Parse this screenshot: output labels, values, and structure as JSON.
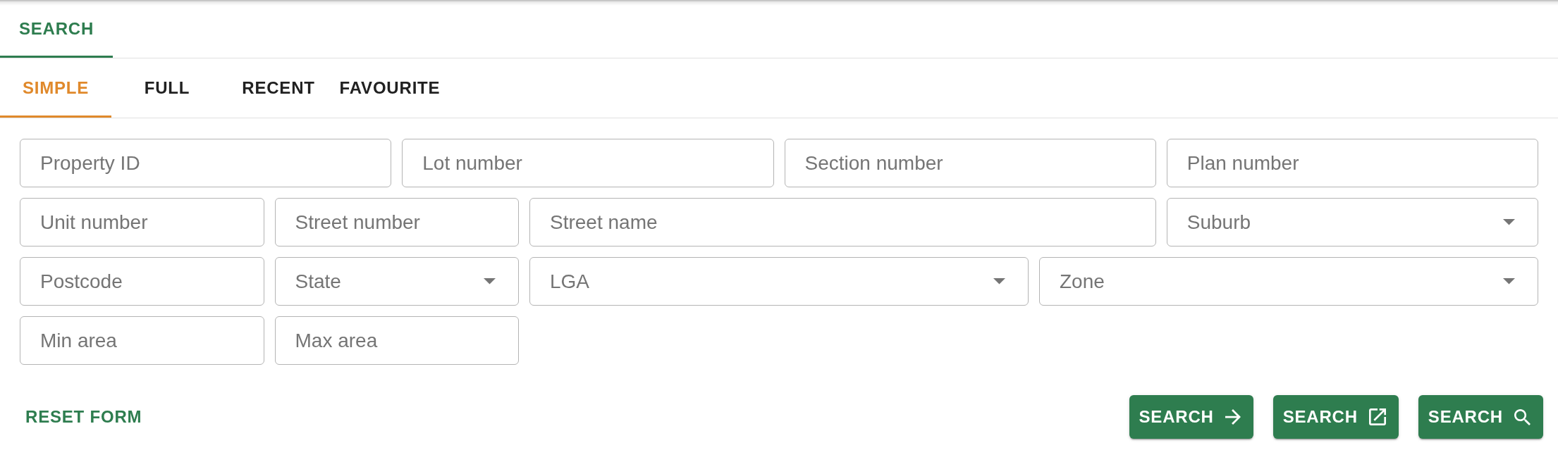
{
  "tabs": [
    {
      "label": "SEARCH",
      "selected": true
    }
  ],
  "search_modes": [
    {
      "label": "SIMPLE",
      "selected": true
    },
    {
      "label": "FULL",
      "selected": false
    },
    {
      "label": "RECENT",
      "selected": false
    },
    {
      "label": "FAVOURITE",
      "selected": false
    }
  ],
  "fields": [
    {
      "kind": "text",
      "placeholder": "Property ID"
    },
    {
      "kind": "text",
      "placeholder": "Lot number"
    },
    {
      "kind": "text",
      "placeholder": "Section number"
    },
    {
      "kind": "text",
      "placeholder": "Plan number"
    },
    {
      "kind": "text",
      "placeholder": "Unit number"
    },
    {
      "kind": "text",
      "placeholder": "Street number"
    },
    {
      "kind": "text",
      "placeholder": "Street name"
    },
    {
      "kind": "select",
      "placeholder": "Suburb"
    },
    {
      "kind": "text",
      "placeholder": "Postcode"
    },
    {
      "kind": "select",
      "placeholder": "State"
    },
    {
      "kind": "select",
      "placeholder": "LGA"
    },
    {
      "kind": "select",
      "placeholder": "Zone"
    },
    {
      "kind": "text",
      "placeholder": "Min area"
    },
    {
      "kind": "text",
      "placeholder": "Max area"
    }
  ],
  "reset_button": {
    "label": "RESET FORM"
  },
  "search_buttons": [
    {
      "label": "SEARCH",
      "kind": "forward"
    },
    {
      "label": "SEARCH",
      "kind": "external"
    },
    {
      "label": "SEARCH",
      "kind": "search"
    }
  ]
}
